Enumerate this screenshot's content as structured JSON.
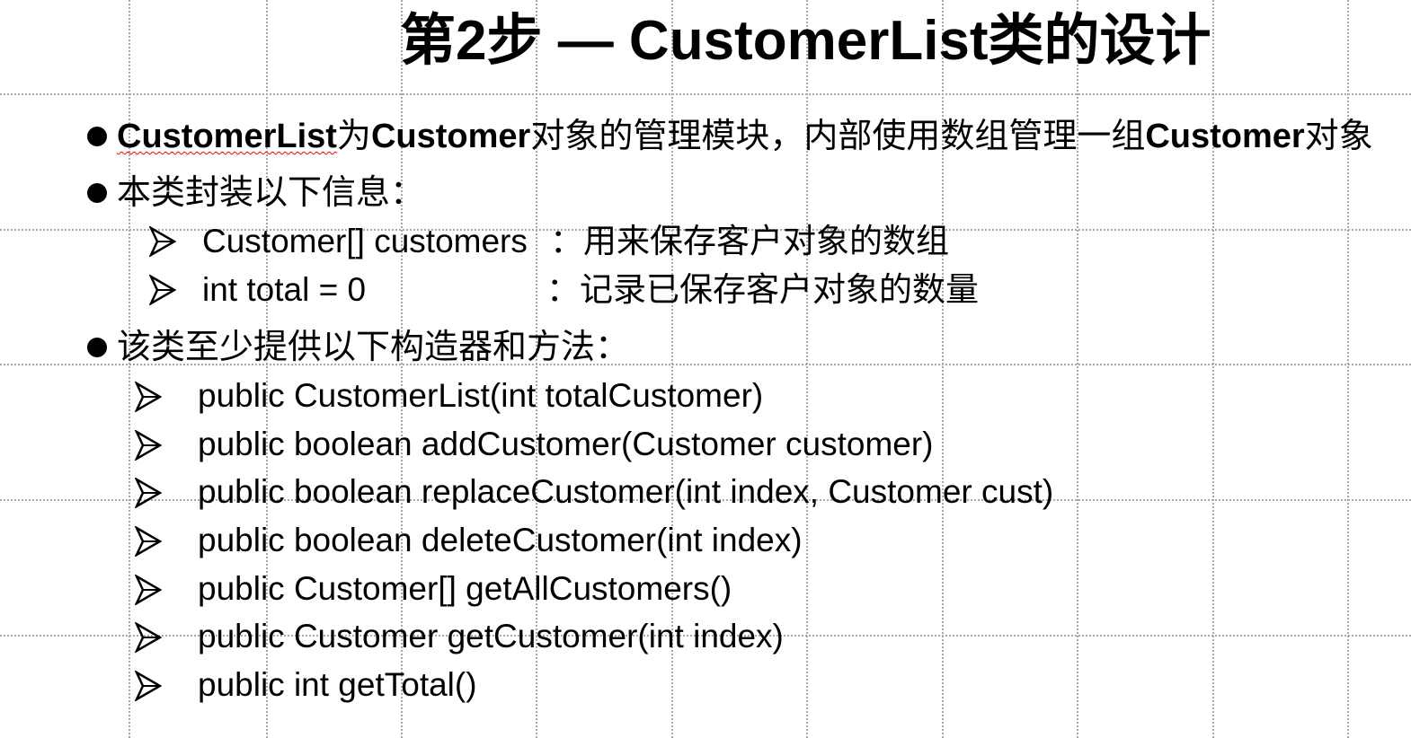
{
  "title": "第2步 — CustomerList类的设计",
  "intro": {
    "part1": "CustomerList",
    "part2": "为",
    "part3": "Customer",
    "part4": "对象的管理模块，内部使用数组管理一组",
    "part5": "Customer",
    "part6": "对象"
  },
  "fields_heading": "本类封装以下信息：",
  "fields": [
    {
      "code": "Customer[] customers",
      "desc": "：用来保存客户对象的数组"
    },
    {
      "code": "int total = 0",
      "desc": "：记录已保存客户对象的数量"
    }
  ],
  "methods_heading": "该类至少提供以下构造器和方法：",
  "methods": [
    "public CustomerList(int totalCustomer)",
    "public boolean addCustomer(Customer customer)",
    "public boolean replaceCustomer(int index, Customer cust)",
    "public boolean deleteCustomer(int index)",
    "public Customer[] getAllCustomers()",
    "public Customer getCustomer(int index)",
    "public int getTotal()"
  ]
}
